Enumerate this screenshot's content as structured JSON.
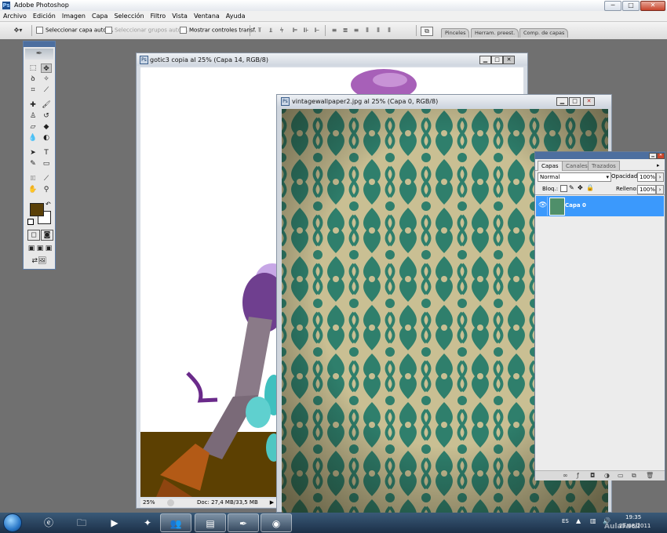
{
  "app": {
    "title": "Adobe Photoshop",
    "icon": "photoshop-icon"
  },
  "window_controls": {
    "minimize": "─",
    "maximize": "□",
    "close": "✕"
  },
  "menu": [
    "Archivo",
    "Edición",
    "Imagen",
    "Capa",
    "Selección",
    "Filtro",
    "Vista",
    "Ventana",
    "Ayuda"
  ],
  "options_bar": {
    "auto_select_layer": "Seleccionar capa autom.",
    "auto_select_groups": "Seleccionar grupos autom.",
    "show_transform": "Mostrar controles transf.",
    "well_tabs": [
      "Pinceles",
      "Herram. preest.",
      "Comp. de capas"
    ]
  },
  "doc1": {
    "title": "gotic3 copia al 25% (Capa 14, RGB/8)",
    "zoom": "25%",
    "doc_size": "Doc: 27,4 MB/33,5 MB"
  },
  "doc2": {
    "title": "vintagewallpaper2.jpg al 25% (Capa 0, RGB/8)"
  },
  "layers_panel": {
    "tabs": [
      "Capas",
      "Canales",
      "Trazados"
    ],
    "blend_mode": "Normal",
    "opacity_label": "Opacidad:",
    "opacity_value": "100%",
    "lock_label": "Bloq.:",
    "fill_label": "Relleno:",
    "fill_value": "100%",
    "layers": [
      {
        "name": "Capa 0",
        "visible": true,
        "selected": true
      }
    ]
  },
  "colors": {
    "foreground": "#5a4008",
    "background": "#ffffff",
    "layer_selected": "#3b99fc",
    "wallpaper_green": "#2f7f6c",
    "wallpaper_beige": "#c9bf93"
  },
  "taskbar": {
    "language": "ES",
    "time": "19:35",
    "date": "21/08/2011",
    "watermark": "AulaFacil"
  }
}
